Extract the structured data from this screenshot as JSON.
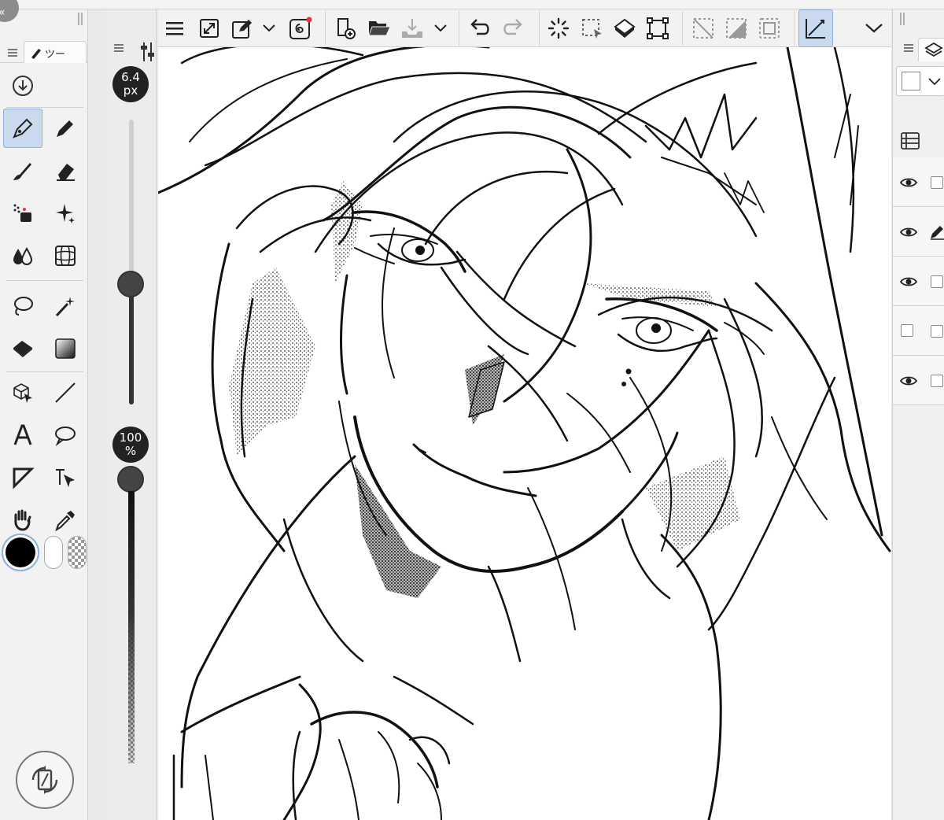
{
  "top_strip": {
    "fragments": [
      "|||",
      "»",
      "«"
    ]
  },
  "tool_panel": {
    "tab_label": "ツー",
    "tools": [
      {
        "name": "download-tool",
        "icon": "download-circle-icon"
      },
      {
        "name": "pen-tool",
        "icon": "pen-nib-icon",
        "active": true
      },
      {
        "name": "pencil-tool",
        "icon": "pencil-icon"
      },
      {
        "name": "brush-tool",
        "icon": "brush-icon"
      },
      {
        "name": "eraser-tool",
        "icon": "eraser-icon"
      },
      {
        "name": "airbrush-tool",
        "icon": "airbrush-icon"
      },
      {
        "name": "decoration-tool",
        "icon": "sparkle-icon"
      },
      {
        "name": "blend-tool",
        "icon": "droplets-icon"
      },
      {
        "name": "mesh-tool",
        "icon": "mesh-icon"
      },
      {
        "name": "lasso-tool",
        "icon": "lasso-icon"
      },
      {
        "name": "magic-wand-tool",
        "icon": "magic-wand-icon"
      },
      {
        "name": "fill-tool",
        "icon": "paint-bucket-icon"
      },
      {
        "name": "gradient-tool",
        "icon": "gradient-icon"
      },
      {
        "name": "operation-tool",
        "icon": "cube-cursor-icon"
      },
      {
        "name": "line-tool",
        "icon": "line-icon"
      },
      {
        "name": "text-tool",
        "icon": "text-a-icon"
      },
      {
        "name": "balloon-tool",
        "icon": "speech-balloon-icon"
      },
      {
        "name": "frame-tool",
        "icon": "frame-border-icon"
      },
      {
        "name": "ruler-tool",
        "icon": "ruler-cursor-icon"
      },
      {
        "name": "hand-tool",
        "icon": "hand-icon"
      },
      {
        "name": "eyedropper-tool",
        "icon": "eyedropper-icon"
      }
    ],
    "colors": {
      "main": "#000000",
      "sub": "#ffffff",
      "transparent": "checker"
    }
  },
  "size_panel": {
    "brush_size_value": "6.4",
    "brush_size_unit": "px",
    "opacity_value": "100",
    "opacity_unit": "%"
  },
  "toolbar": {
    "buttons": [
      {
        "name": "menu-button",
        "icon": "hamburger-icon"
      },
      {
        "name": "fit-view-button",
        "icon": "expand-diagonal-icon"
      },
      {
        "name": "modify-button",
        "icon": "edit-box-icon"
      },
      {
        "name": "modify-dropdown",
        "icon": "chevron-down-icon"
      },
      {
        "name": "companion-button",
        "icon": "spiral-icon"
      },
      {
        "name": "new-canvas-button",
        "icon": "new-file-icon"
      },
      {
        "name": "open-button",
        "icon": "folder-icon"
      },
      {
        "name": "save-button",
        "icon": "save-tray-icon"
      },
      {
        "name": "save-dropdown",
        "icon": "chevron-down-icon"
      },
      {
        "name": "undo-button",
        "icon": "undo-icon"
      },
      {
        "name": "redo-button",
        "icon": "redo-icon"
      },
      {
        "name": "loading-indicator",
        "icon": "spinner-icon"
      },
      {
        "name": "select-all-button",
        "icon": "dashed-select-icon"
      },
      {
        "name": "fill-button",
        "icon": "fill-icon"
      },
      {
        "name": "transform-button",
        "icon": "transform-icon"
      },
      {
        "name": "deselect-button",
        "icon": "deselect-icon"
      },
      {
        "name": "invert-selection-button",
        "icon": "invert-icon"
      },
      {
        "name": "selection-border-button",
        "icon": "border-icon"
      },
      {
        "name": "snap-button",
        "icon": "snap-ruler-icon",
        "active": true
      },
      {
        "name": "toolbar-more-button",
        "icon": "chevron-down-icon"
      }
    ]
  },
  "layer_panel": {
    "tab_icon": "layers-icon",
    "rows": [
      {
        "visible": true,
        "thumbnail": "blank"
      },
      {
        "visible": true,
        "thumbnail": "pencil"
      },
      {
        "visible": true,
        "thumbnail": "blank"
      },
      {
        "visible": false,
        "thumbnail": "blank"
      },
      {
        "visible": true,
        "thumbnail": "blank"
      }
    ]
  }
}
